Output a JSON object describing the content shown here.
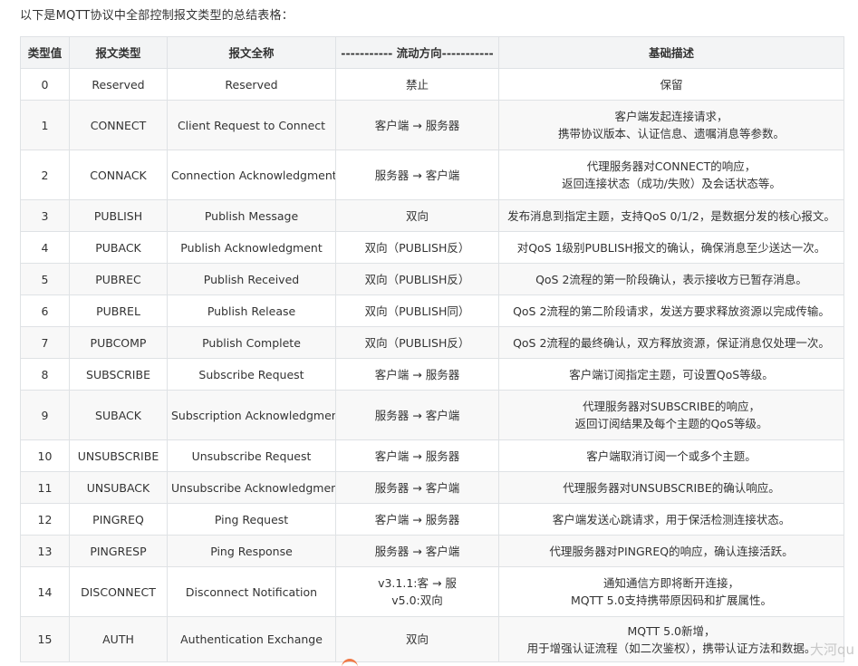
{
  "intro": "以下是MQTT协议中全部控制报文类型的总结表格：",
  "table": {
    "headers": [
      "类型值",
      "报文类型",
      "报文全称",
      "----------- 流动方向-----------",
      "基础描述"
    ],
    "rows": [
      {
        "value": "0",
        "type": "Reserved",
        "full": "Reserved",
        "dir": [
          "禁止"
        ],
        "desc": [
          "保留"
        ]
      },
      {
        "value": "1",
        "type": "CONNECT",
        "full": "Client Request to Connect",
        "dir": [
          "客户端 → 服务器"
        ],
        "desc": [
          "客户端发起连接请求，",
          "携带协议版本、认证信息、遗嘱消息等参数。"
        ]
      },
      {
        "value": "2",
        "type": "CONNACK",
        "full": "Connection Acknowledgment",
        "dir": [
          "服务器 → 客户端"
        ],
        "desc": [
          "代理服务器对CONNECT的响应，",
          "返回连接状态（成功/失败）及会话状态等。"
        ]
      },
      {
        "value": "3",
        "type": "PUBLISH",
        "full": "Publish Message",
        "dir": [
          "双向"
        ],
        "desc": [
          "发布消息到指定主题，支持QoS 0/1/2，是数据分发的核心报文。"
        ]
      },
      {
        "value": "4",
        "type": "PUBACK",
        "full": "Publish Acknowledgment",
        "dir": [
          "双向（PUBLISH反）"
        ],
        "desc": [
          "对QoS 1级别PUBLISH报文的确认，确保消息至少送达一次。"
        ]
      },
      {
        "value": "5",
        "type": "PUBREC",
        "full": "Publish Received",
        "dir": [
          "双向（PUBLISH反）"
        ],
        "desc": [
          "QoS 2流程的第一阶段确认，表示接收方已暂存消息。"
        ]
      },
      {
        "value": "6",
        "type": "PUBREL",
        "full": "Publish Release",
        "dir": [
          "双向（PUBLISH同）"
        ],
        "desc": [
          "QoS 2流程的第二阶段请求，发送方要求释放资源以完成传输。"
        ]
      },
      {
        "value": "7",
        "type": "PUBCOMP",
        "full": "Publish Complete",
        "dir": [
          "双向（PUBLISH反）"
        ],
        "desc": [
          "QoS 2流程的最终确认，双方释放资源，保证消息仅处理一次。"
        ]
      },
      {
        "value": "8",
        "type": "SUBSCRIBE",
        "full": "Subscribe Request",
        "dir": [
          "客户端 → 服务器"
        ],
        "desc": [
          "客户端订阅指定主题，可设置QoS等级。"
        ]
      },
      {
        "value": "9",
        "type": "SUBACK",
        "full": "Subscription Acknowledgment",
        "dir": [
          "服务器 → 客户端"
        ],
        "desc": [
          "代理服务器对SUBSCRIBE的响应，",
          "返回订阅结果及每个主题的QoS等级。"
        ]
      },
      {
        "value": "10",
        "type": "UNSUBSCRIBE",
        "full": "Unsubscribe Request",
        "dir": [
          "客户端 → 服务器"
        ],
        "desc": [
          "客户端取消订阅一个或多个主题。"
        ]
      },
      {
        "value": "11",
        "type": "UNSUBACK",
        "full": "Unsubscribe Acknowledgment",
        "dir": [
          "服务器 → 客户端"
        ],
        "desc": [
          "代理服务器对UNSUBSCRIBE的确认响应。"
        ]
      },
      {
        "value": "12",
        "type": "PINGREQ",
        "full": "Ping Request",
        "dir": [
          "客户端 → 服务器"
        ],
        "desc": [
          "客户端发送心跳请求，用于保活检测连接状态。"
        ]
      },
      {
        "value": "13",
        "type": "PINGRESP",
        "full": "Ping Response",
        "dir": [
          "服务器 → 客户端"
        ],
        "desc": [
          "代理服务器对PINGREQ的响应，确认连接活跃。"
        ]
      },
      {
        "value": "14",
        "type": "DISCONNECT",
        "full": "Disconnect Notification",
        "dir": [
          "v3.1.1:客 → 服",
          "v5.0:双向"
        ],
        "desc": [
          "通知通信方即将断开连接，",
          "MQTT 5.0支持携带原因码和扩展属性。"
        ]
      },
      {
        "value": "15",
        "type": "AUTH",
        "full": "Authentication Exchange",
        "dir": [
          "双向"
        ],
        "desc": [
          "MQTT 5.0新增，",
          "用于增强认证流程（如二次鉴权），携带认证方法和数据。"
        ]
      }
    ]
  },
  "watermark": "大河qu"
}
